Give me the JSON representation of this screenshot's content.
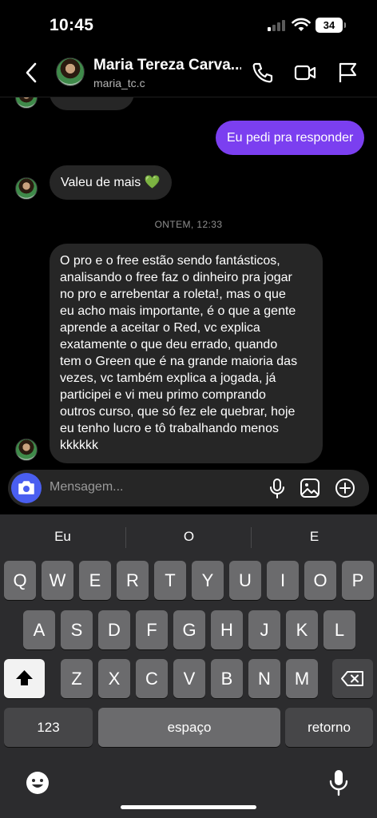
{
  "status_bar": {
    "time": "10:45",
    "battery": "34"
  },
  "header": {
    "name": "Maria Tereza Carva...",
    "username": "maria_tc.c"
  },
  "messages": [
    {
      "direction": "outgoing",
      "text": "Eu pedi pra responder"
    },
    {
      "direction": "incoming",
      "text": "Valeu de mais 💚"
    },
    {
      "direction": "timestamp",
      "text": "ONTEM, 12:33"
    },
    {
      "direction": "incoming",
      "lines": [
        "O pro e o free estão sendo fantásticos,",
        "analisando o free faz o dinheiro pra jogar",
        "no pro e arrebentar a roleta!, mas o que",
        "eu acho mais importante, é o que a gente",
        "aprende a aceitar o Red, vc explica",
        "exatamente o que deu errado, quando",
        "tem o Green que é na grande maioria das",
        "vezes, vc também explica a jogada, já",
        "participei e vi meu primo comprando",
        "outros curso, que só fez ele quebrar, hoje",
        "eu tenho lucro e tô trabalhando menos",
        "kkkkkk"
      ]
    }
  ],
  "composer": {
    "placeholder": "Mensagem..."
  },
  "keyboard": {
    "suggestions": [
      "Eu",
      "O",
      "E"
    ],
    "row1": [
      "Q",
      "W",
      "E",
      "R",
      "T",
      "Y",
      "U",
      "I",
      "O",
      "P"
    ],
    "row2": [
      "A",
      "S",
      "D",
      "F",
      "G",
      "H",
      "J",
      "K",
      "L"
    ],
    "row3": [
      "Z",
      "X",
      "C",
      "V",
      "B",
      "N",
      "M"
    ],
    "numbers_key": "123",
    "space_key": "espaço",
    "return_key": "retorno"
  },
  "colors": {
    "accent": "#7b3ff0",
    "camera_button": "#4a5ff0",
    "bubble_incoming": "#262626"
  },
  "icons": [
    "back-arrow-icon",
    "phone-icon",
    "video-icon",
    "flag-icon",
    "camera-icon",
    "microphone-icon",
    "image-icon",
    "plus-circle-icon",
    "shift-icon",
    "backspace-icon",
    "emoji-icon",
    "dictation-mic-icon"
  ]
}
